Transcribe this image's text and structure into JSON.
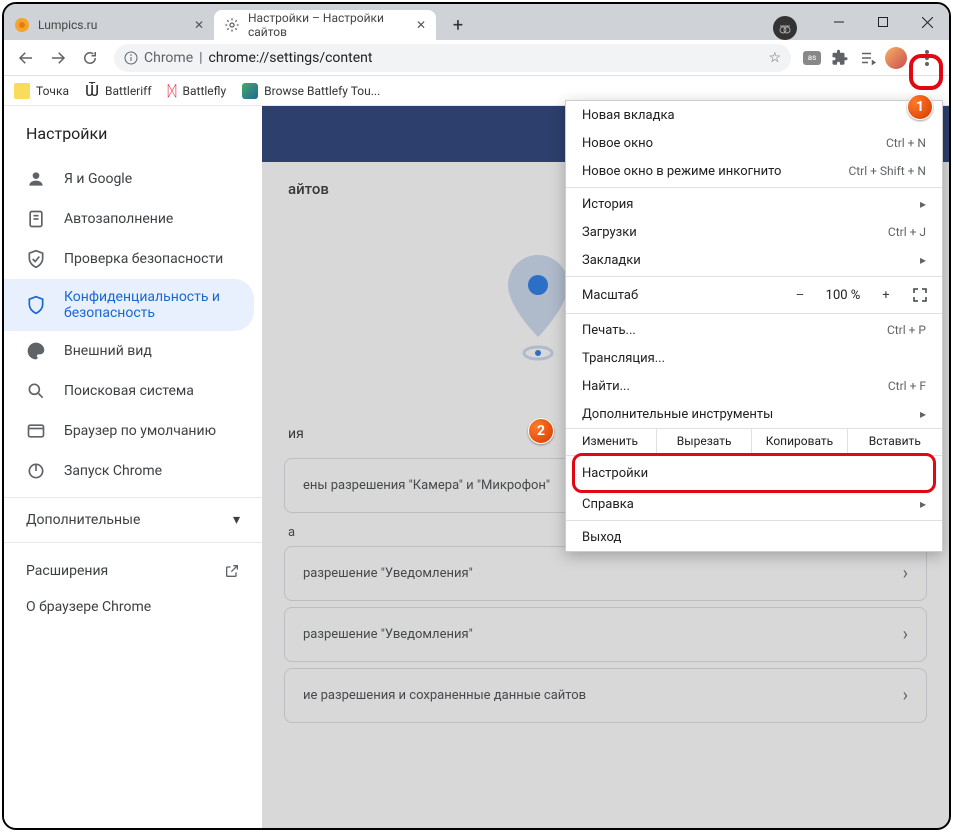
{
  "tabs": {
    "bg": {
      "title": "Lumpics.ru"
    },
    "active": {
      "title": "Настройки – Настройки сайтов"
    }
  },
  "omnibox": {
    "chip": "Chrome",
    "url": "chrome://settings/content"
  },
  "bookmarks": {
    "b0": "Точка",
    "b1": "Battleriff",
    "b2": "Battlefly",
    "b3": "Browse Battlefy Tou..."
  },
  "sidebar": {
    "title": "Настройки",
    "items": {
      "0": {
        "label": "Я и Google"
      },
      "1": {
        "label": "Автозаполнение"
      },
      "2": {
        "label": "Проверка безопасности"
      },
      "3": {
        "label": "Конфиденциальность и безопасность"
      },
      "4": {
        "label": "Внешний вид"
      },
      "5": {
        "label": "Поисковая система"
      },
      "6": {
        "label": "Браузер по умолчанию"
      },
      "7": {
        "label": "Запуск Chrome"
      }
    },
    "more": "Дополнительные",
    "ext": "Расширения",
    "about": "О браузере Chrome"
  },
  "main": {
    "heading": "айтов",
    "subhead": "ия",
    "rows": {
      "0": "ены разрешения \"Камера\" и \"Микрофон\"",
      "1": "разрешение \"Уведомления\"",
      "1b": "а",
      "2": "разрешение \"Уведомления\"",
      "3": "ие разрешения и сохраненные данные сайтов"
    }
  },
  "menu": {
    "newtab": "Новая вкладка",
    "newwin": "Новое окно",
    "newwin_sc": "Ctrl + N",
    "incog": "Новое окно в режиме инкогнито",
    "incog_sc": "Ctrl + Shift + N",
    "history": "История",
    "downloads": "Загрузки",
    "downloads_sc": "Ctrl + J",
    "bookmarks": "Закладки",
    "zoom": "Масштаб",
    "zoom_pct": "100 %",
    "print": "Печать...",
    "print_sc": "Ctrl + P",
    "cast": "Трансляция...",
    "find": "Найти...",
    "find_sc": "Ctrl + F",
    "moretools": "Дополнительные инструменты",
    "edit": "Изменить",
    "cut": "Вырезать",
    "copy": "Копировать",
    "paste": "Вставить",
    "settings": "Настройки",
    "help": "Справка",
    "exit": "Выход"
  },
  "badges": {
    "b1": "1",
    "b2": "2"
  }
}
